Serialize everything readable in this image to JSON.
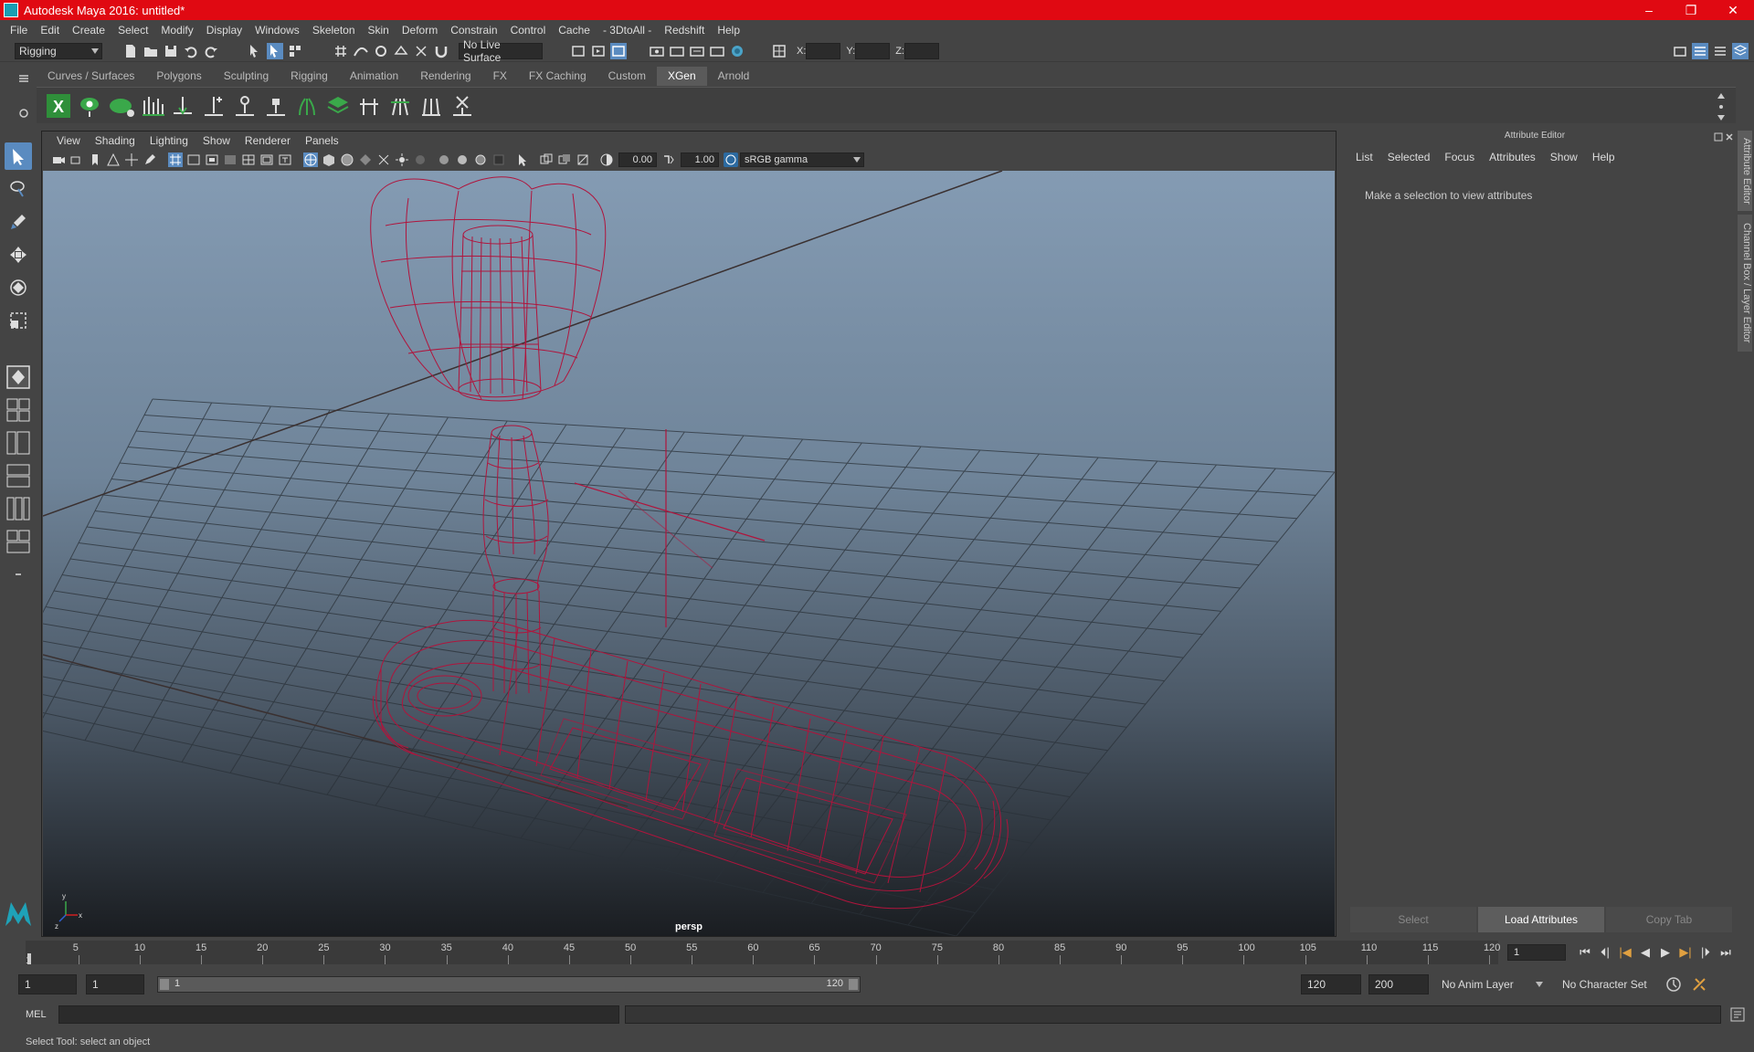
{
  "window": {
    "title": "Autodesk Maya 2016: untitled*",
    "controls": [
      "–",
      "❐",
      "✕"
    ]
  },
  "menubar": [
    "File",
    "Edit",
    "Create",
    "Select",
    "Modify",
    "Display",
    "Windows",
    "Skeleton",
    "Skin",
    "Deform",
    "Constrain",
    "Control",
    "Cache",
    "- 3DtoAll -",
    "Redshift",
    "Help"
  ],
  "statusline": {
    "menuset": "Rigging",
    "live_surface": "No Live Surface",
    "x_label": "X:",
    "y_label": "Y:",
    "z_label": "Z:"
  },
  "shelf": {
    "tabs": [
      "Curves / Surfaces",
      "Polygons",
      "Sculpting",
      "Rigging",
      "Animation",
      "Rendering",
      "FX",
      "FX Caching",
      "Custom",
      "XGen",
      "Arnold"
    ],
    "active_tab": "XGen"
  },
  "viewport": {
    "menus": [
      "View",
      "Shading",
      "Lighting",
      "Show",
      "Renderer",
      "Panels"
    ],
    "exposure": "0.00",
    "gamma": "1.00",
    "color_space": "sRGB gamma",
    "camera": "persp"
  },
  "attribute_editor": {
    "title": "Attribute Editor",
    "menus": [
      "List",
      "Selected",
      "Focus",
      "Attributes",
      "Show",
      "Help"
    ],
    "message": "Make a selection to view attributes",
    "buttons": [
      "Select",
      "Load Attributes",
      "Copy Tab"
    ],
    "side_tabs": [
      "Attribute Editor",
      "Channel Box / Layer Editor"
    ]
  },
  "timeslider": {
    "ticks": [
      5,
      10,
      15,
      20,
      25,
      30,
      35,
      40,
      45,
      50,
      55,
      60,
      65,
      70,
      75,
      80,
      85,
      90,
      95,
      100,
      105,
      110,
      115,
      120
    ],
    "start_label": "1",
    "current_frame": "1"
  },
  "rangeslider": {
    "start": "1",
    "playback_start": "1",
    "range_start": "1",
    "range_end": "120",
    "playback_end": "120",
    "end": "200",
    "anim_layer": "No Anim Layer",
    "character_set": "No Character Set"
  },
  "command_line": {
    "label": "MEL"
  },
  "help_line": "Select Tool: select an object",
  "colors": {
    "title_bar": "#e00912",
    "wireframe": "#b0143c",
    "accent": "#5a8bc0"
  }
}
